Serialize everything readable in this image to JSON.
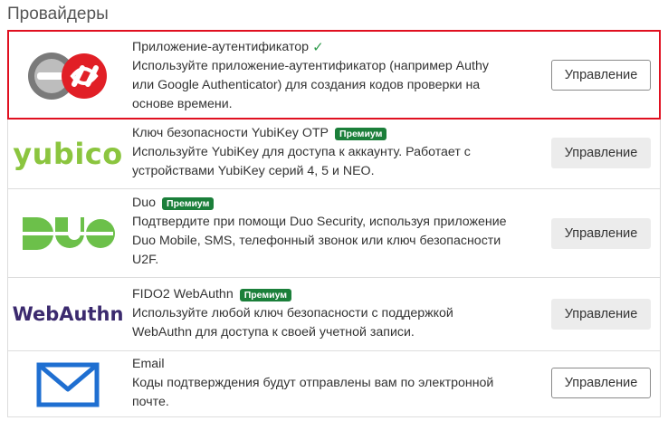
{
  "heading": "Провайдеры",
  "manage_label": "Управление",
  "premium_label": "Премиум",
  "colors": {
    "selected_outline": "#e01020",
    "premium_badge": "#1b7f3a",
    "yubico": "#8bc53f",
    "duo": "#6cc04a",
    "webauthn": "#3b2a6e",
    "email": "#1f6fd1"
  },
  "providers": [
    {
      "title": "Приложение-аутентификатор",
      "desc1": "Используйте приложение-аутентификатор (например Authy",
      "desc2": "или Google Authenticator) для создания кодов проверки на",
      "desc3": "основе времени.",
      "icon": "authenticator-logo"
    },
    {
      "title": "Ключ безопасности YubiKey OTP",
      "desc1": "Используйте YubiKey для доступа к аккаунту. Работает с",
      "desc2": "устройствами YubiKey серий 4, 5 и NEO.",
      "logo_text": "yubico"
    },
    {
      "title": "Duo",
      "desc1": "Подтвердите при помощи Duo Security, используя приложение",
      "desc2": "Duo Mobile, SMS, телефонный звонок или ключ безопасности",
      "desc3": "U2F."
    },
    {
      "title": "FIDO2 WebAuthn",
      "desc1": "Используйте любой ключ безопасности с поддержкой",
      "desc2": "WebAuthn для доступа к своей учетной записи.",
      "logo_text": "WebAuthn"
    },
    {
      "title": "Email",
      "desc1": "Коды подтверждения будут отправлены вам по электронной",
      "desc2": "почте."
    }
  ]
}
